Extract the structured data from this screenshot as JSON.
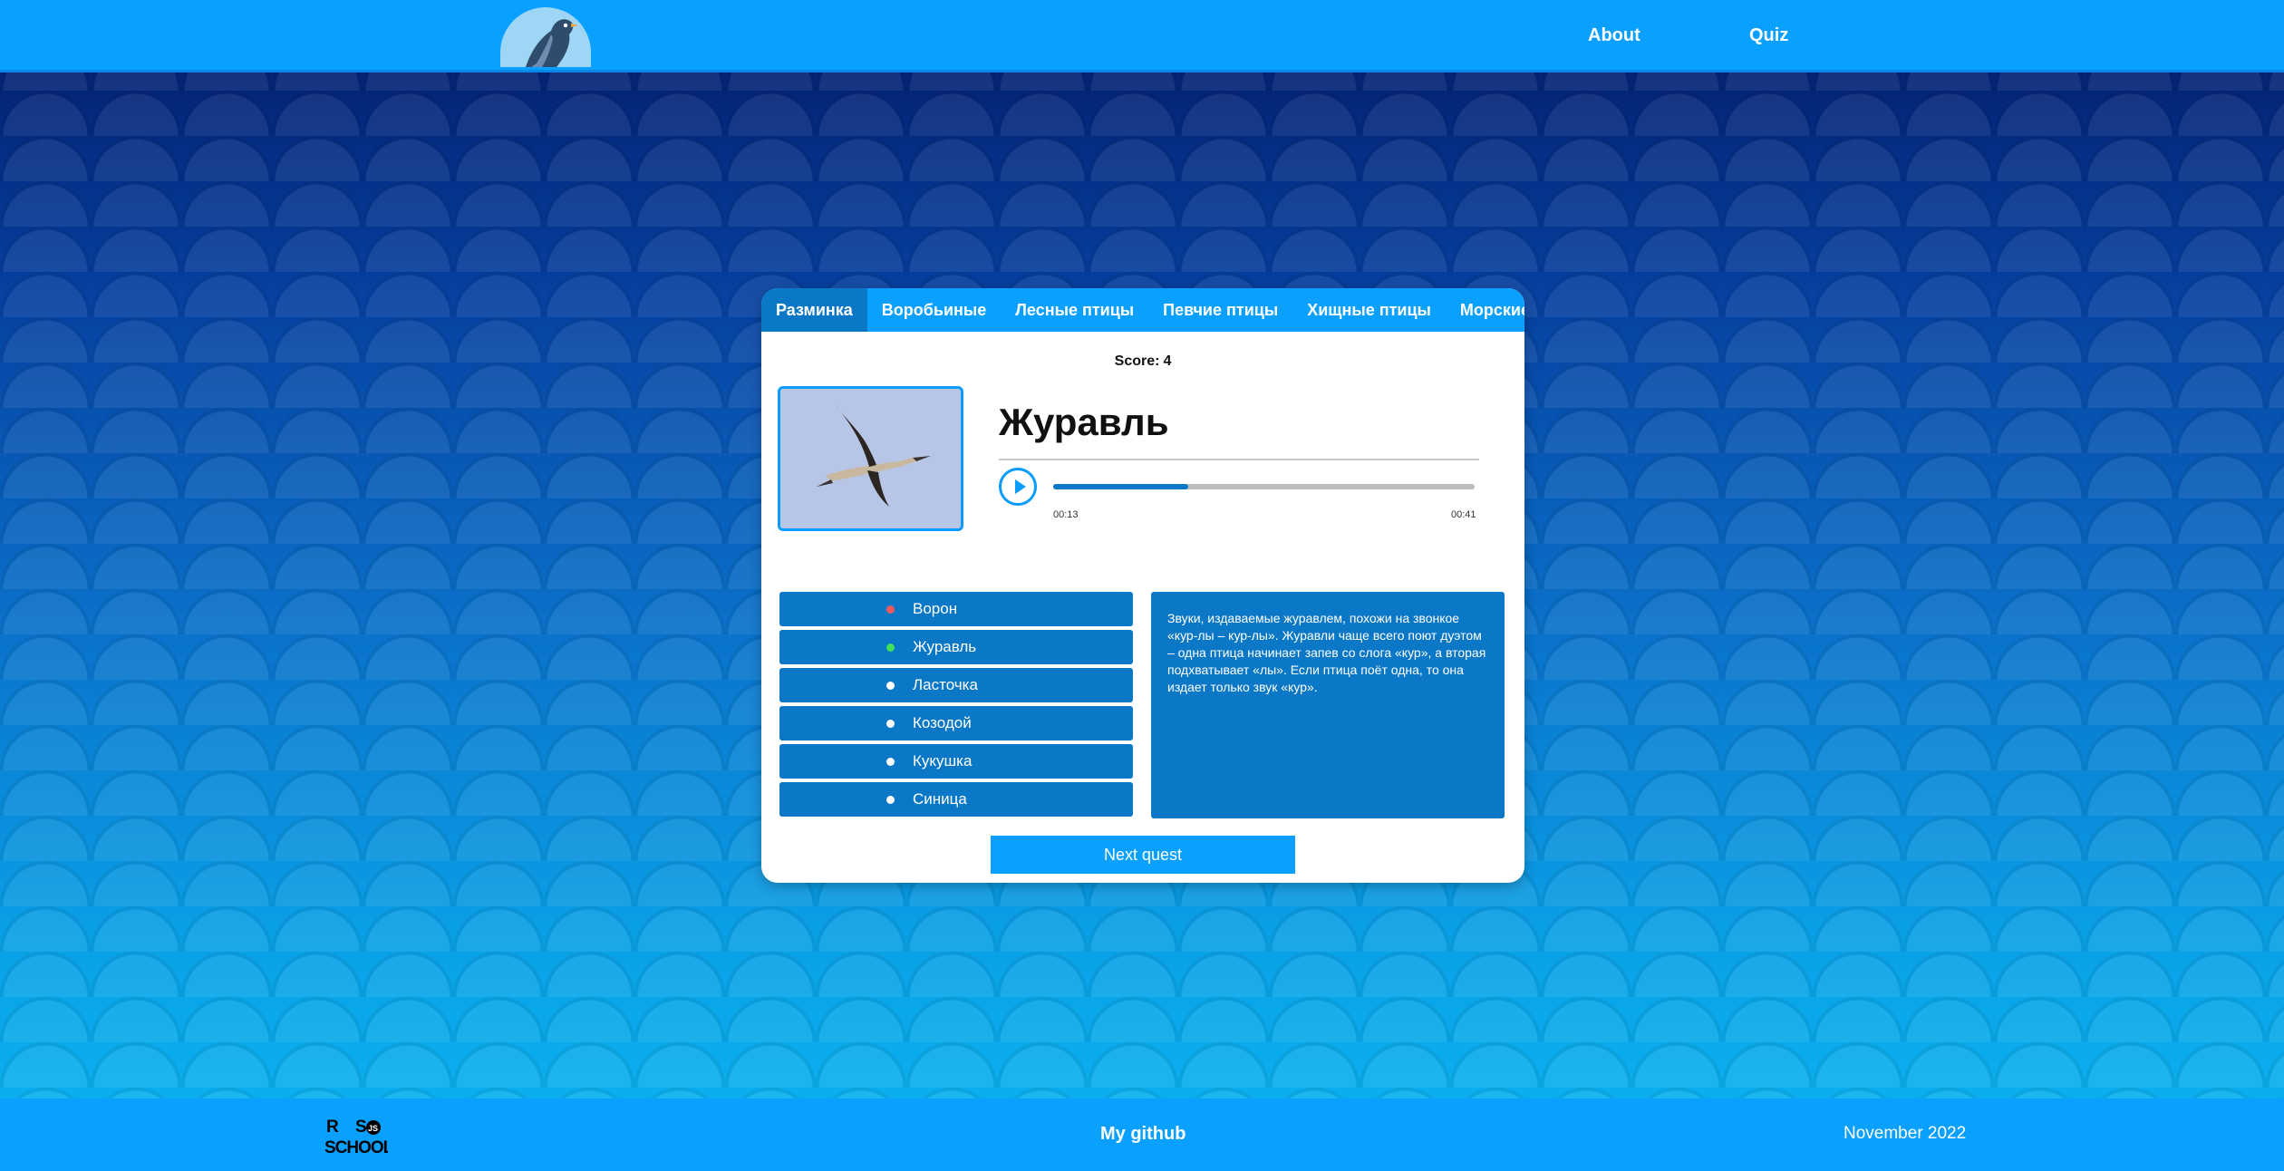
{
  "header": {
    "nav": [
      {
        "label": "About"
      },
      {
        "label": "Quiz"
      }
    ]
  },
  "quiz": {
    "tabs": [
      {
        "label": "Разминка",
        "active": true
      },
      {
        "label": "Воробьиные",
        "active": false
      },
      {
        "label": "Лесные птицы",
        "active": false
      },
      {
        "label": "Певчие птицы",
        "active": false
      },
      {
        "label": "Хищные птицы",
        "active": false
      },
      {
        "label": "Морские птицы",
        "active": false
      }
    ],
    "score_label": "Score:",
    "score_value": "4",
    "bird_name": "Журавль",
    "player": {
      "current_time": "00:13",
      "duration": "00:41",
      "progress_fraction": 0.32
    },
    "answers": [
      {
        "label": "Ворон",
        "status": "wrong",
        "dot_color": "#f05a5a"
      },
      {
        "label": "Журавль",
        "status": "correct",
        "dot_color": "#3fe05a"
      },
      {
        "label": "Ласточка",
        "status": "none",
        "dot_color": "#ffffff"
      },
      {
        "label": "Козодой",
        "status": "none",
        "dot_color": "#ffffff"
      },
      {
        "label": "Кукушка",
        "status": "none",
        "dot_color": "#ffffff"
      },
      {
        "label": "Синица",
        "status": "none",
        "dot_color": "#ffffff"
      }
    ],
    "description": "Звуки, издаваемые журавлем, похожи на звонкое «кур-лы – кур-лы». Журавли чаще всего поют дуэтом – одна птица начинает запев со слога «кур», а вторая подхватывает «лы». Если птица поёт одна, то она издает только звук «кур».",
    "next_button": "Next quest"
  },
  "footer": {
    "rs_logo_text": "RS SCHOOL JS",
    "github_label": "My github",
    "date": "November 2022"
  },
  "colors": {
    "primary": "#0aa0ff",
    "panel": "#0a78c7",
    "correct": "#3fe05a",
    "wrong": "#f05a5a"
  }
}
